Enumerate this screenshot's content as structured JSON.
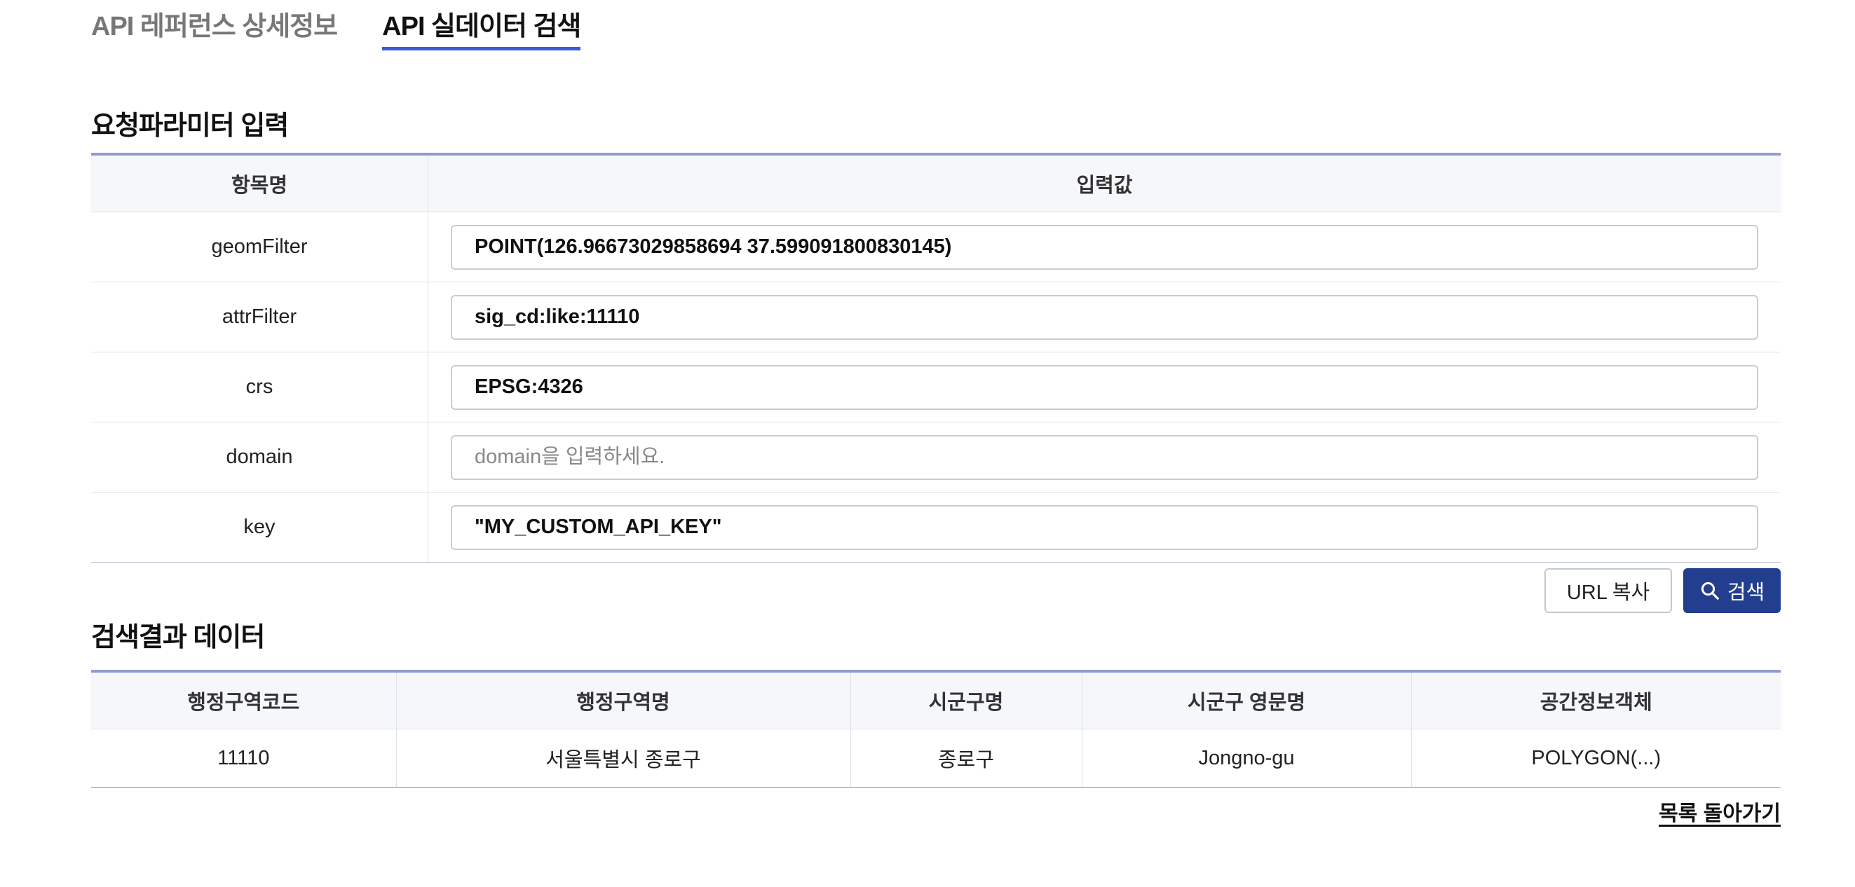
{
  "tabs": [
    {
      "label": "API 레퍼런스 상세정보",
      "active": false
    },
    {
      "label": "API 실데이터 검색",
      "active": true
    }
  ],
  "params_section": {
    "title": "요청파라미터 입력",
    "headers": {
      "name": "항목명",
      "value": "입력값"
    },
    "rows": [
      {
        "name": "geomFilter",
        "value": "POINT(126.96673029858694 37.599091800830145)",
        "placeholder": ""
      },
      {
        "name": "attrFilter",
        "value": "sig_cd:like:11110",
        "placeholder": ""
      },
      {
        "name": "crs",
        "value": "EPSG:4326",
        "placeholder": ""
      },
      {
        "name": "domain",
        "value": "",
        "placeholder": "domain을 입력하세요."
      },
      {
        "name": "key",
        "value": "\"MY_CUSTOM_API_KEY\"",
        "placeholder": ""
      }
    ]
  },
  "buttons": {
    "copy_url": "URL 복사",
    "search": "검색",
    "search_icon": "search-icon",
    "primary_color": "#233d8f"
  },
  "results_section": {
    "title": "검색결과 데이터",
    "headers": [
      "행정구역코드",
      "행정구역명",
      "시군구명",
      "시군구 영문명",
      "공간정보객체"
    ],
    "rows": [
      [
        "11110",
        "서울특별시 종로구",
        "종로구",
        "Jongno-gu",
        "POLYGON(...)"
      ]
    ]
  },
  "back_link": "목록 돌아가기",
  "accent_color": "#3a5bd9"
}
